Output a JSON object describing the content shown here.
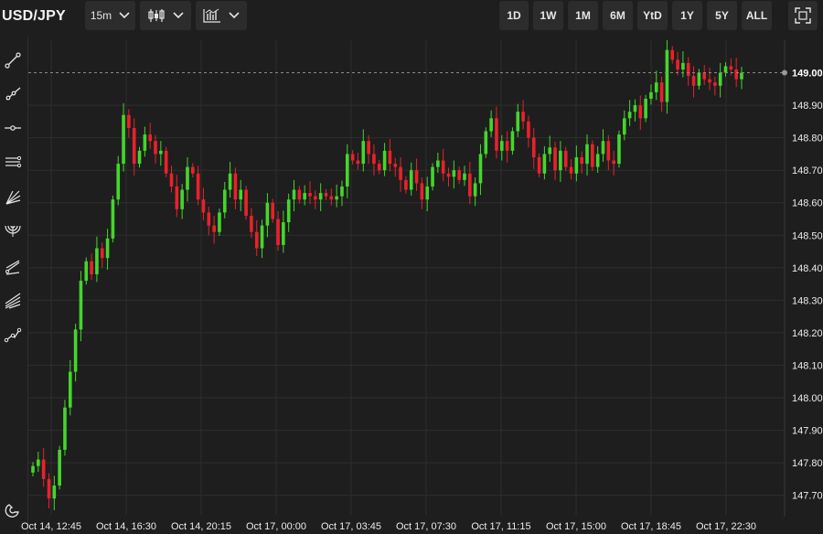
{
  "header": {
    "symbol": "USD/JPY",
    "interval": "15m",
    "chart_style_icon": "candlestick-icon",
    "indicators_icon": "indicators-icon",
    "ranges": [
      "1D",
      "1W",
      "1M",
      "6M",
      "YtD",
      "1Y",
      "5Y",
      "ALL"
    ],
    "fullscreen_icon": "fullscreen-icon"
  },
  "sidebar": {
    "tools": [
      "trend-line-icon",
      "ray-icon",
      "horizontal-line-icon",
      "parallel-channel-icon",
      "fan-icon",
      "arc-icon",
      "pitchfork-icon",
      "gann-icon",
      "path-icon"
    ],
    "bottom_tool": "magnet-icon"
  },
  "colors": {
    "up": "#44d62c",
    "down": "#e8222b",
    "bg": "#1e1e1e",
    "grid": "#2e2e2e",
    "axis_text": "#ececec"
  },
  "chart_data": {
    "type": "candlestick",
    "title": "USD/JPY",
    "x_tick_labels": [
      "Oct 14, 12:45",
      "Oct 14, 16:30",
      "Oct 14, 20:15",
      "Oct 17, 00:00",
      "Oct 17, 03:45",
      "Oct 17, 07:30",
      "Oct 17, 11:15",
      "Oct 17, 15:00",
      "Oct 17, 18:45",
      "Oct 17, 22:30"
    ],
    "y_ticks": [
      147.7,
      147.8,
      147.9,
      148.0,
      148.1,
      148.2,
      148.3,
      148.4,
      148.5,
      148.6,
      148.7,
      148.8,
      148.9
    ],
    "ylim": [
      147.64,
      149.1
    ],
    "last_price": "149.00",
    "grid": true,
    "closes": [
      147.79,
      147.81,
      147.75,
      147.69,
      147.73,
      147.84,
      147.97,
      148.08,
      148.21,
      148.36,
      148.42,
      148.38,
      148.46,
      148.43,
      148.49,
      148.61,
      148.72,
      148.87,
      148.83,
      148.72,
      148.76,
      148.81,
      148.79,
      148.75,
      148.76,
      148.69,
      148.65,
      148.58,
      148.64,
      148.71,
      148.69,
      148.61,
      148.57,
      148.53,
      148.51,
      148.57,
      148.64,
      148.69,
      148.61,
      148.64,
      148.56,
      148.51,
      148.46,
      148.53,
      148.6,
      148.55,
      148.47,
      148.54,
      148.61,
      148.64,
      148.61,
      148.63,
      148.62,
      148.61,
      148.63,
      148.62,
      148.61,
      148.62,
      148.65,
      148.75,
      148.73,
      148.72,
      148.79,
      148.75,
      148.72,
      148.7,
      148.76,
      148.72,
      148.71,
      148.67,
      148.64,
      148.7,
      148.66,
      148.61,
      148.65,
      148.71,
      148.73,
      148.69,
      148.68,
      148.7,
      148.67,
      148.69,
      148.62,
      148.66,
      148.75,
      148.82,
      148.86,
      148.76,
      148.79,
      148.76,
      148.82,
      148.88,
      148.85,
      148.8,
      148.74,
      148.69,
      148.75,
      148.77,
      148.7,
      148.76,
      148.71,
      148.69,
      148.74,
      148.72,
      148.78,
      148.71,
      148.75,
      148.79,
      148.73,
      148.72,
      148.81,
      148.86,
      148.88,
      148.9,
      148.86,
      148.92,
      148.94,
      148.97,
      148.91,
      149.07,
      149.04,
      149.01,
      149.03,
      148.99,
      148.96,
      149.0,
      148.98,
      148.97,
      148.96,
      149.0,
      149.02,
      149.01,
      148.98,
      149.0
    ]
  }
}
